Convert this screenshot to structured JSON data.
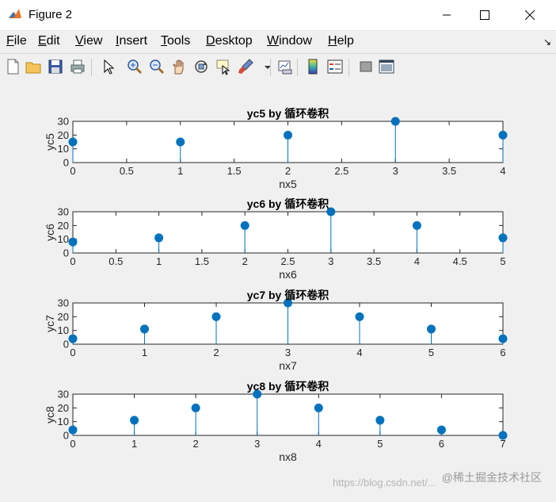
{
  "window": {
    "title": "Figure 2"
  },
  "menu": [
    {
      "label": "File",
      "u": "F",
      "rest": "ile"
    },
    {
      "label": "Edit",
      "u": "E",
      "rest": "dit"
    },
    {
      "label": "View",
      "u": "V",
      "rest": "iew"
    },
    {
      "label": "Insert",
      "u": "I",
      "rest": "nsert"
    },
    {
      "label": "Tools",
      "u": "T",
      "rest": "ools"
    },
    {
      "label": "Desktop",
      "u": "D",
      "rest": "esktop"
    },
    {
      "label": "Window",
      "u": "W",
      "rest": "indow"
    },
    {
      "label": "Help",
      "u": "H",
      "rest": "elp"
    }
  ],
  "toolbar_icons": [
    "new-figure-icon",
    "open-file-icon",
    "save-icon",
    "print-icon",
    "select-arrow-icon",
    "zoom-in-icon",
    "zoom-out-icon",
    "pan-hand-icon",
    "rotate-3d-icon",
    "data-cursor-icon",
    "brush-icon",
    "dropdown-arrow-icon",
    "link-plot-icon",
    "colorbar-icon",
    "legend-icon",
    "hide-plot-tools-icon",
    "show-plot-tools-icon"
  ],
  "accent_color": "#0072BD",
  "chart_data": [
    {
      "type": "stem",
      "title": "yc5 by 循环卷积",
      "xlabel": "nx5",
      "ylabel": "yc5",
      "xlim": [
        0,
        4
      ],
      "ylim": [
        0,
        30
      ],
      "xticks": [
        "0",
        "0.5",
        "1",
        "1.5",
        "2",
        "2.5",
        "3",
        "3.5",
        "4"
      ],
      "yticks": [
        "0",
        "10",
        "20",
        "30"
      ],
      "x": [
        0,
        1,
        2,
        3,
        4
      ],
      "values": [
        15,
        15,
        20,
        30,
        20
      ]
    },
    {
      "type": "stem",
      "title": "yc6 by 循环卷积",
      "xlabel": "nx6",
      "ylabel": "yc6",
      "xlim": [
        0,
        5
      ],
      "ylim": [
        0,
        30
      ],
      "xticks": [
        "0",
        "0.5",
        "1",
        "1.5",
        "2",
        "2.5",
        "3",
        "3.5",
        "4",
        "4.5",
        "5"
      ],
      "yticks": [
        "0",
        "10",
        "20",
        "30"
      ],
      "x": [
        0,
        1,
        2,
        3,
        4,
        5
      ],
      "values": [
        8,
        11,
        20,
        30,
        20,
        11
      ]
    },
    {
      "type": "stem",
      "title": "yc7 by 循环卷积",
      "xlabel": "nx7",
      "ylabel": "yc7",
      "xlim": [
        0,
        6
      ],
      "ylim": [
        0,
        30
      ],
      "xticks": [
        "0",
        "1",
        "2",
        "3",
        "4",
        "5",
        "6"
      ],
      "yticks": [
        "0",
        "10",
        "20",
        "30"
      ],
      "x": [
        0,
        1,
        2,
        3,
        4,
        5,
        6
      ],
      "values": [
        4,
        11,
        20,
        30,
        20,
        11,
        4
      ]
    },
    {
      "type": "stem",
      "title": "yc8 by 循环卷积",
      "xlabel": "nx8",
      "ylabel": "yc8",
      "xlim": [
        0,
        7
      ],
      "ylim": [
        0,
        30
      ],
      "xticks": [
        "0",
        "1",
        "2",
        "3",
        "4",
        "5",
        "6",
        "7"
      ],
      "yticks": [
        "0",
        "10",
        "20",
        "30"
      ],
      "x": [
        0,
        1,
        2,
        3,
        4,
        5,
        6,
        7
      ],
      "values": [
        4,
        11,
        20,
        30,
        20,
        11,
        4,
        0
      ]
    }
  ],
  "watermark": "@稀土掘金技术社区",
  "watermark_url": "https://blog.csdn.net/..."
}
